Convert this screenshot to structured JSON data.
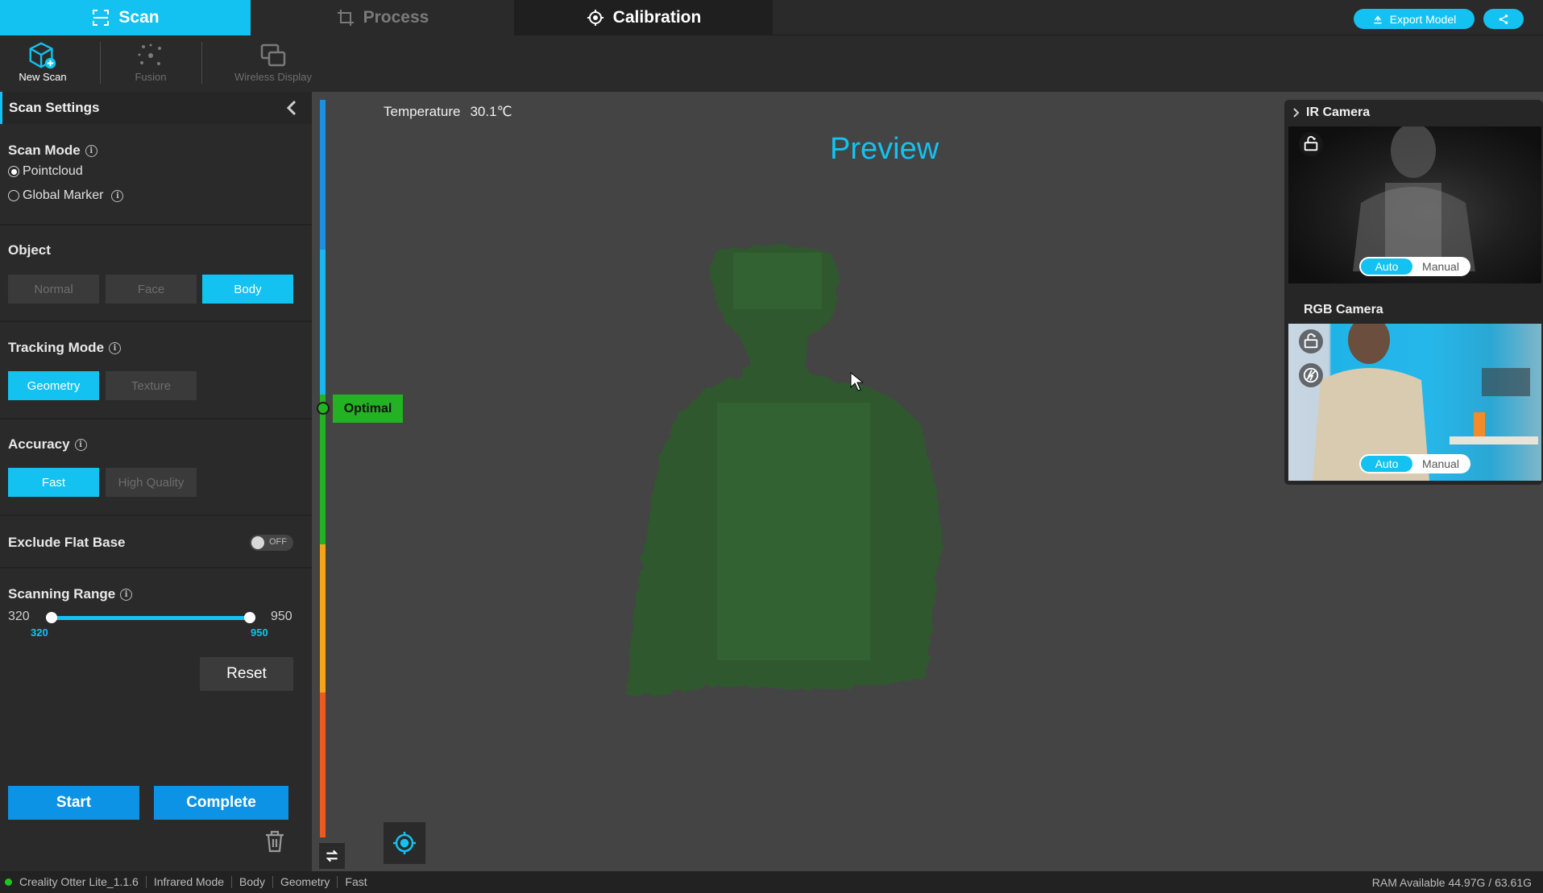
{
  "tabs": {
    "scan": "Scan",
    "process": "Process",
    "calibration": "Calibration"
  },
  "header": {
    "export_label": "Export Model"
  },
  "toolbar": {
    "new_scan": "New Scan",
    "fusion": "Fusion",
    "wireless_display": "Wireless Display"
  },
  "settings": {
    "title": "Scan Settings",
    "scan_mode": {
      "label": "Scan Mode",
      "options": [
        "Pointcloud",
        "Global Marker"
      ],
      "selected": "Pointcloud"
    },
    "object": {
      "label": "Object",
      "options": [
        "Normal",
        "Face",
        "Body"
      ],
      "selected": "Body"
    },
    "tracking_mode": {
      "label": "Tracking Mode",
      "options": [
        "Geometry",
        "Texture"
      ],
      "selected": "Geometry"
    },
    "accuracy": {
      "label": "Accuracy",
      "options": [
        "Fast",
        "High Quality"
      ],
      "selected": "Fast"
    },
    "exclude_flat_base": {
      "label": "Exclude Flat Base",
      "state": "OFF"
    },
    "scanning_range": {
      "label": "Scanning Range",
      "min": "320",
      "max": "950",
      "low_value": "320",
      "high_value": "950"
    },
    "reset_label": "Reset",
    "start_label": "Start",
    "complete_label": "Complete"
  },
  "viewport": {
    "temperature_label": "Temperature",
    "temperature_value": "30.1℃",
    "preview_label": "Preview",
    "distance_status": "Optimal"
  },
  "cameras": {
    "ir": {
      "title": "IR Camera",
      "auto": "Auto",
      "manual": "Manual"
    },
    "rgb": {
      "title": "RGB Camera",
      "auto": "Auto",
      "manual": "Manual"
    }
  },
  "statusbar": {
    "app": "Creality Otter Lite_1.1.6",
    "mode": "Infrared Mode",
    "object": "Body",
    "tracking": "Geometry",
    "accuracy": "Fast",
    "ram": "RAM Available 44.97G / 63.61G"
  },
  "colors": {
    "accent": "#13c2f0",
    "primary_button": "#0d93e5",
    "optimal": "#23b223",
    "point_cloud": "#2e5a2e"
  },
  "icons": {
    "scan_tab": "scan-frame-icon",
    "process_tab": "crop-icon",
    "calibration_tab": "crosshair-icon",
    "export": "export-icon",
    "share": "share-icon",
    "new_scan": "cube-plus-icon",
    "fusion": "fusion-icon",
    "wireless": "wireless-display-icon",
    "collapse": "chevron-left-icon",
    "trash": "trash-icon",
    "swap": "swap-icon",
    "locate": "locate-target-icon",
    "rotate": "rotate-camera-icon",
    "flash_off": "flash-off-icon"
  }
}
